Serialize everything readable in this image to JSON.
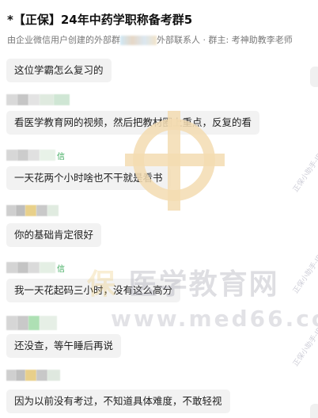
{
  "header": {
    "title": "*【正保】24年中药学职称备考群5",
    "subtitle_prefix": "由企业微信用户创建的外部群",
    "subtitle_suffix": "外部联系人 · 群主: 考神助教李老师"
  },
  "messages": [
    {
      "text": "这位学霸怎么复习的"
    },
    {
      "text": "看医学教育网的视频，然后把教材圈上重点，反复的看"
    },
    {
      "text": "一天花两个小时啥也不干就是看书",
      "sender_tag": "信"
    },
    {
      "text": "你的基础肯定很好"
    },
    {
      "text": "我一天花起码三小时，没有这么高分",
      "sender_tag": "信"
    },
    {
      "text": "还没查，等午睡后再说"
    },
    {
      "text": "因为以前没有考过，不知道具体难度，不敢轻视"
    }
  ],
  "watermark": {
    "brand_accent": "保",
    "brand": "医学教育网",
    "url": "www.med66.com",
    "side_text": "正保小助手-ID"
  }
}
